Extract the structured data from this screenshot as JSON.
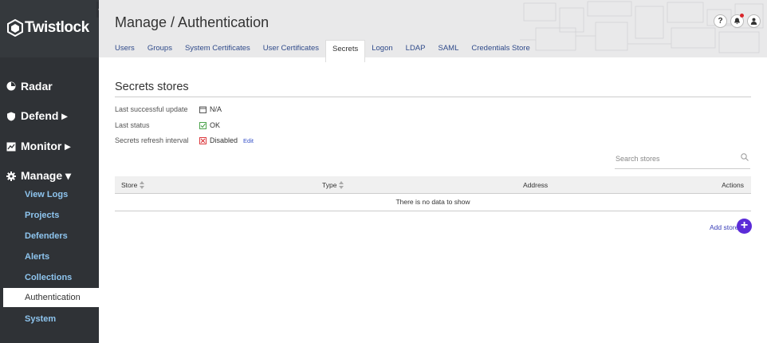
{
  "brand": {
    "name": "Twistlock"
  },
  "sidebar": {
    "nav": [
      {
        "label": "Radar",
        "icon": "radar-icon"
      },
      {
        "label": "Defend ▸",
        "icon": "shield-icon"
      },
      {
        "label": "Monitor ▸",
        "icon": "monitor-icon"
      },
      {
        "label": "Manage ▾",
        "icon": "gear-icon"
      }
    ],
    "sub_items": [
      "View Logs",
      "Projects",
      "Defenders",
      "Alerts",
      "Collections",
      "Authentication",
      "System"
    ],
    "active_sub": "Authentication"
  },
  "header": {
    "title": "Manage / Authentication",
    "tabs": [
      "Users",
      "Groups",
      "System Certificates",
      "User Certificates",
      "Secrets",
      "Logon",
      "LDAP",
      "SAML",
      "Credentials Store"
    ],
    "active_tab": "Secrets",
    "help_label": "?"
  },
  "section": {
    "title": "Secrets stores",
    "rows": [
      {
        "label": "Last successful update",
        "value": "N/A",
        "icon": "calendar-icon"
      },
      {
        "label": "Last status",
        "value": "OK",
        "icon": "check-icon"
      },
      {
        "label": "Secrets refresh interval",
        "value": "Disabled",
        "icon": "x-icon",
        "link": "Edit"
      }
    ]
  },
  "search": {
    "placeholder": "Search stores"
  },
  "table": {
    "columns": [
      "Store",
      "Type",
      "Address",
      "Actions"
    ],
    "empty_text": "There is no data to show"
  },
  "add": {
    "label": "Add store",
    "button": "+"
  },
  "colors": {
    "sidebar_bg": "#2f3236",
    "link_blue": "#8ec5ef",
    "accent_purple": "#5b2bd8",
    "ok_green": "#3a9a3a",
    "error_red": "#d9262b"
  }
}
